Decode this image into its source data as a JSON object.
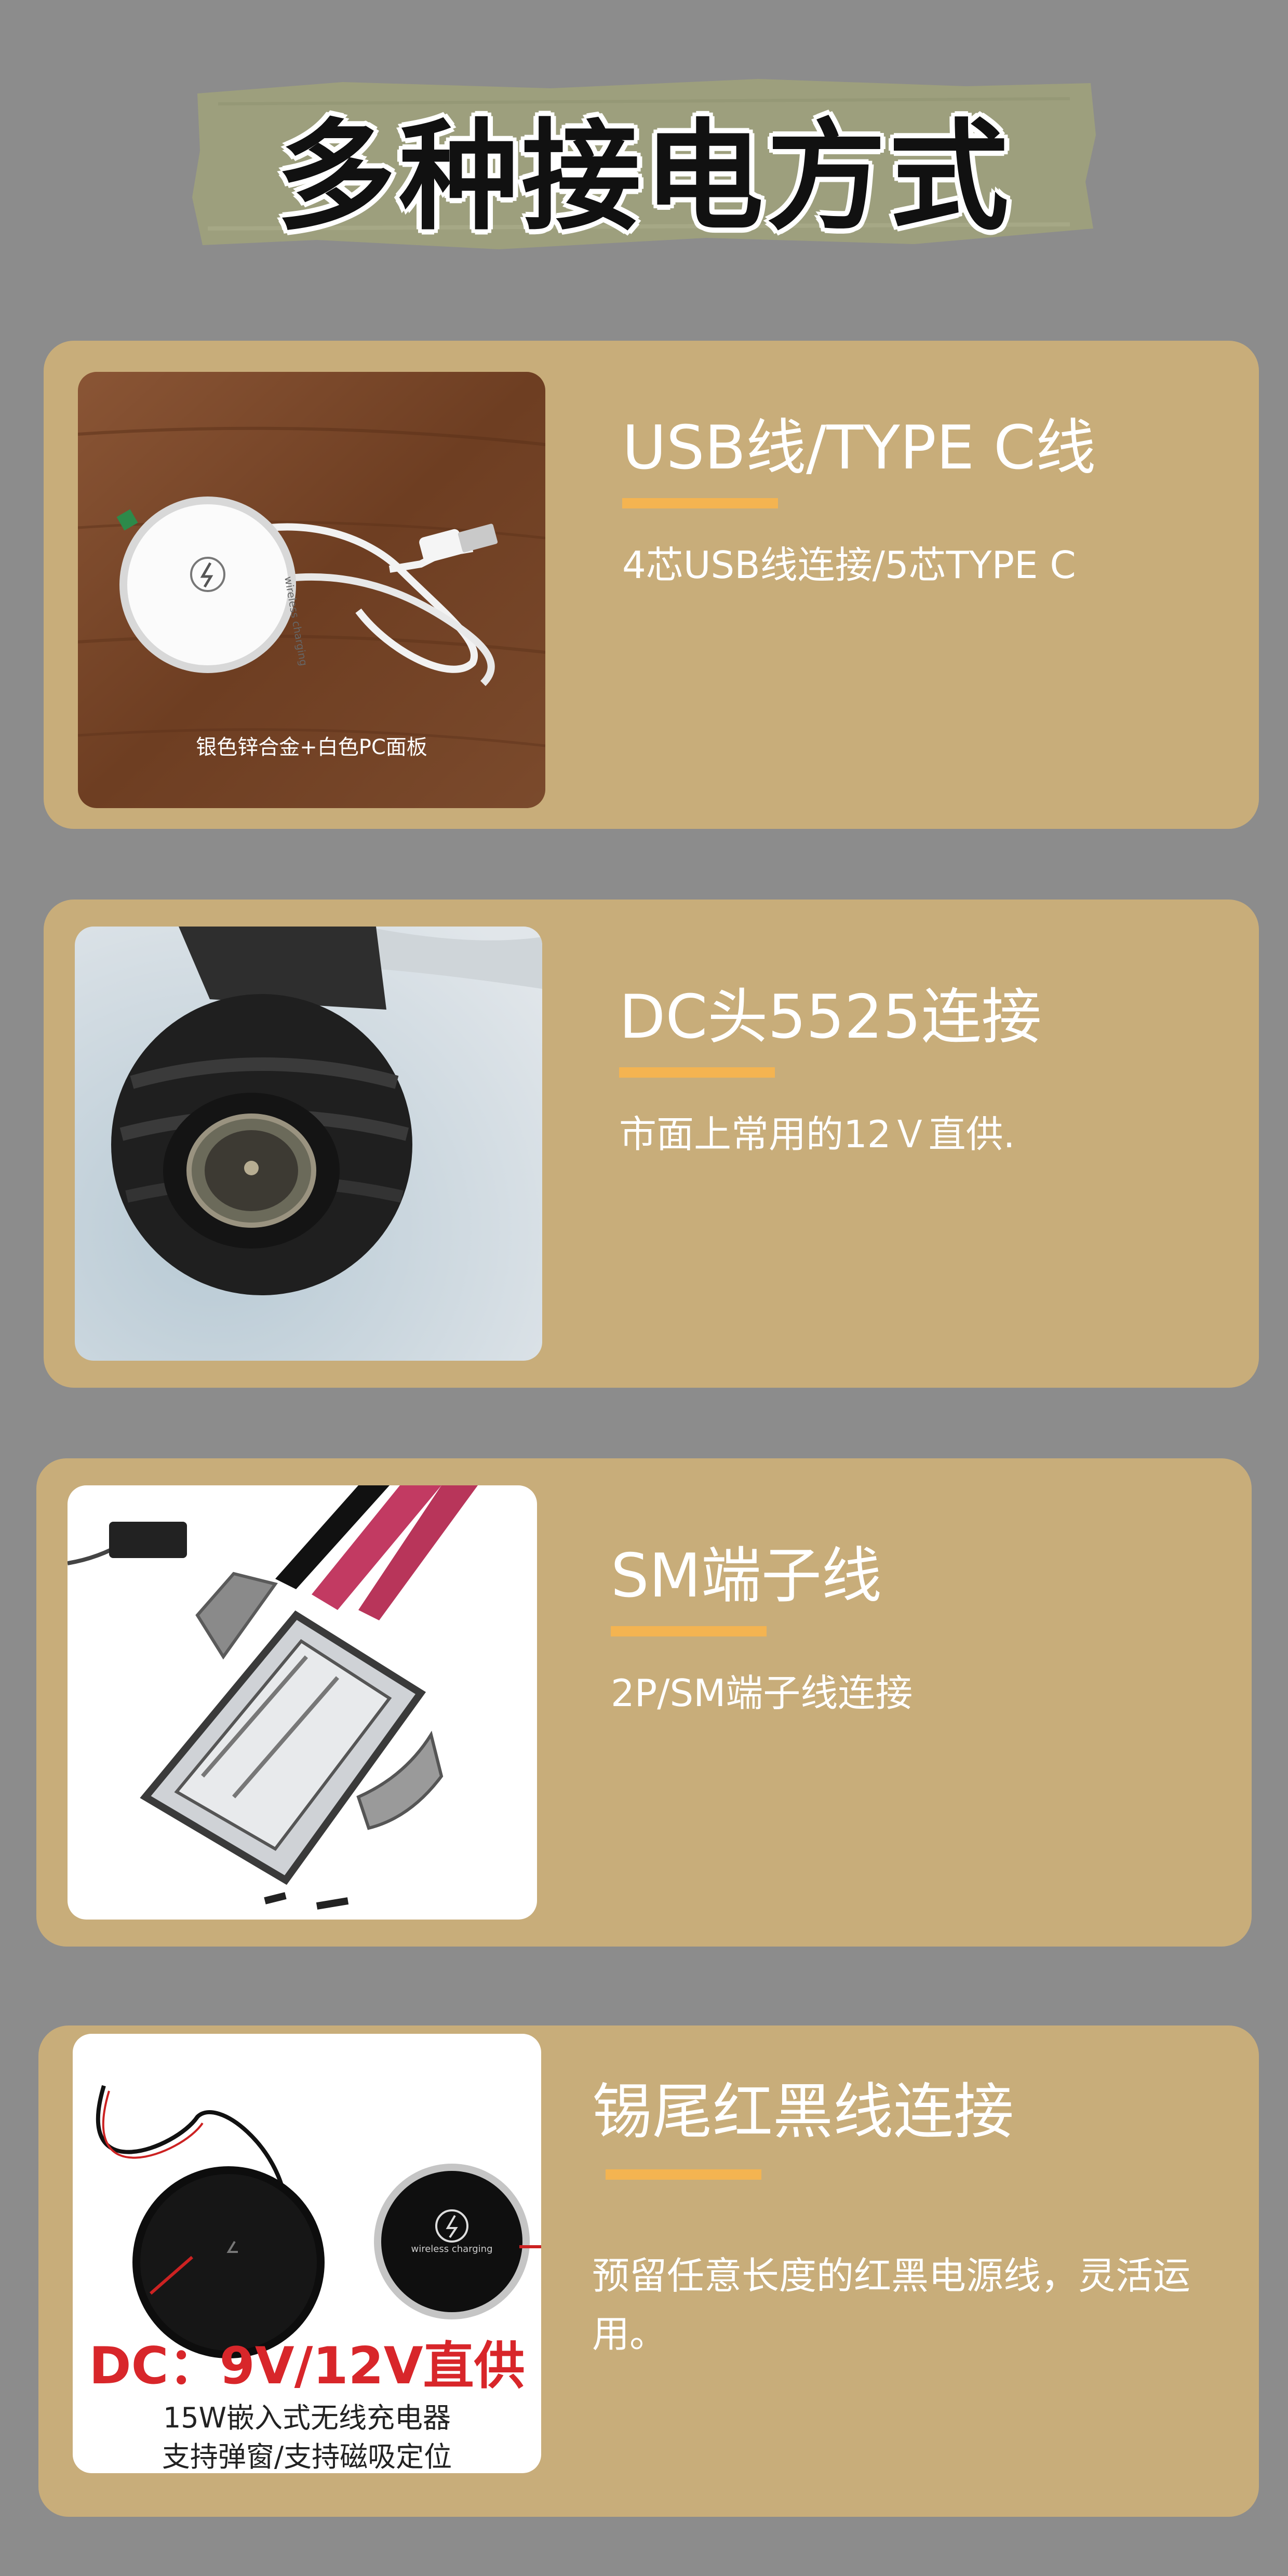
{
  "page_title": "多种接电方式",
  "colors": {
    "background": "#8c8c8c",
    "card": "#c8ad7a",
    "accent": "#f4b451",
    "banner_brush": "#9ea07c",
    "overlay_red": "#d8262a"
  },
  "cards": [
    {
      "title": "USB线/TYPE C线",
      "description": "4芯USB线连接/5芯TYPE C",
      "photo": {
        "caption": "银色锌合金+白色PC面板",
        "pad_print": "wireless charging",
        "icon": "bolt-icon"
      }
    },
    {
      "title": "DC头5525连接",
      "description": "市面上常用的12Ｖ直供."
    },
    {
      "title": "SM端子线",
      "description": "2P/SM端子线连接"
    },
    {
      "title": "锡尾红黑线连接",
      "description": "预留任意长度的红黑电源线，灵活运用。",
      "photo": {
        "pad_print": "wireless charging",
        "headline": "DC：9V/12V直供",
        "line1": "15W嵌入式无线充电器",
        "line2": "支持弹窗/支持磁吸定位"
      }
    }
  ]
}
